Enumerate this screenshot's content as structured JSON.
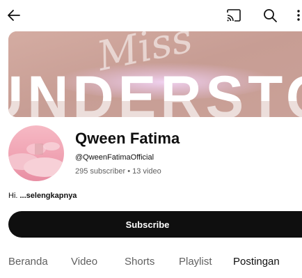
{
  "header": {
    "back_icon": "arrow-left-icon",
    "cast_icon": "cast-icon",
    "search_icon": "search-icon",
    "more_icon": "more-vertical-icon"
  },
  "banner": {
    "script_text": "Miss",
    "block_text": "UNDERSTOOD",
    "colors": {
      "background": "#c9a097",
      "text": "#ffffff"
    }
  },
  "channel": {
    "name": "Qween Fatima",
    "handle": "@QweenFatimaOfficial",
    "stats": "295 subscriber • 13 video",
    "description": "Hi. ",
    "more_label": "...selengkapnya"
  },
  "subscribe": {
    "label": "Subscribe"
  },
  "tabs": [
    "Beranda",
    "Video",
    "Shorts",
    "Playlist",
    "Postingan"
  ],
  "active_tab": "Postingan"
}
